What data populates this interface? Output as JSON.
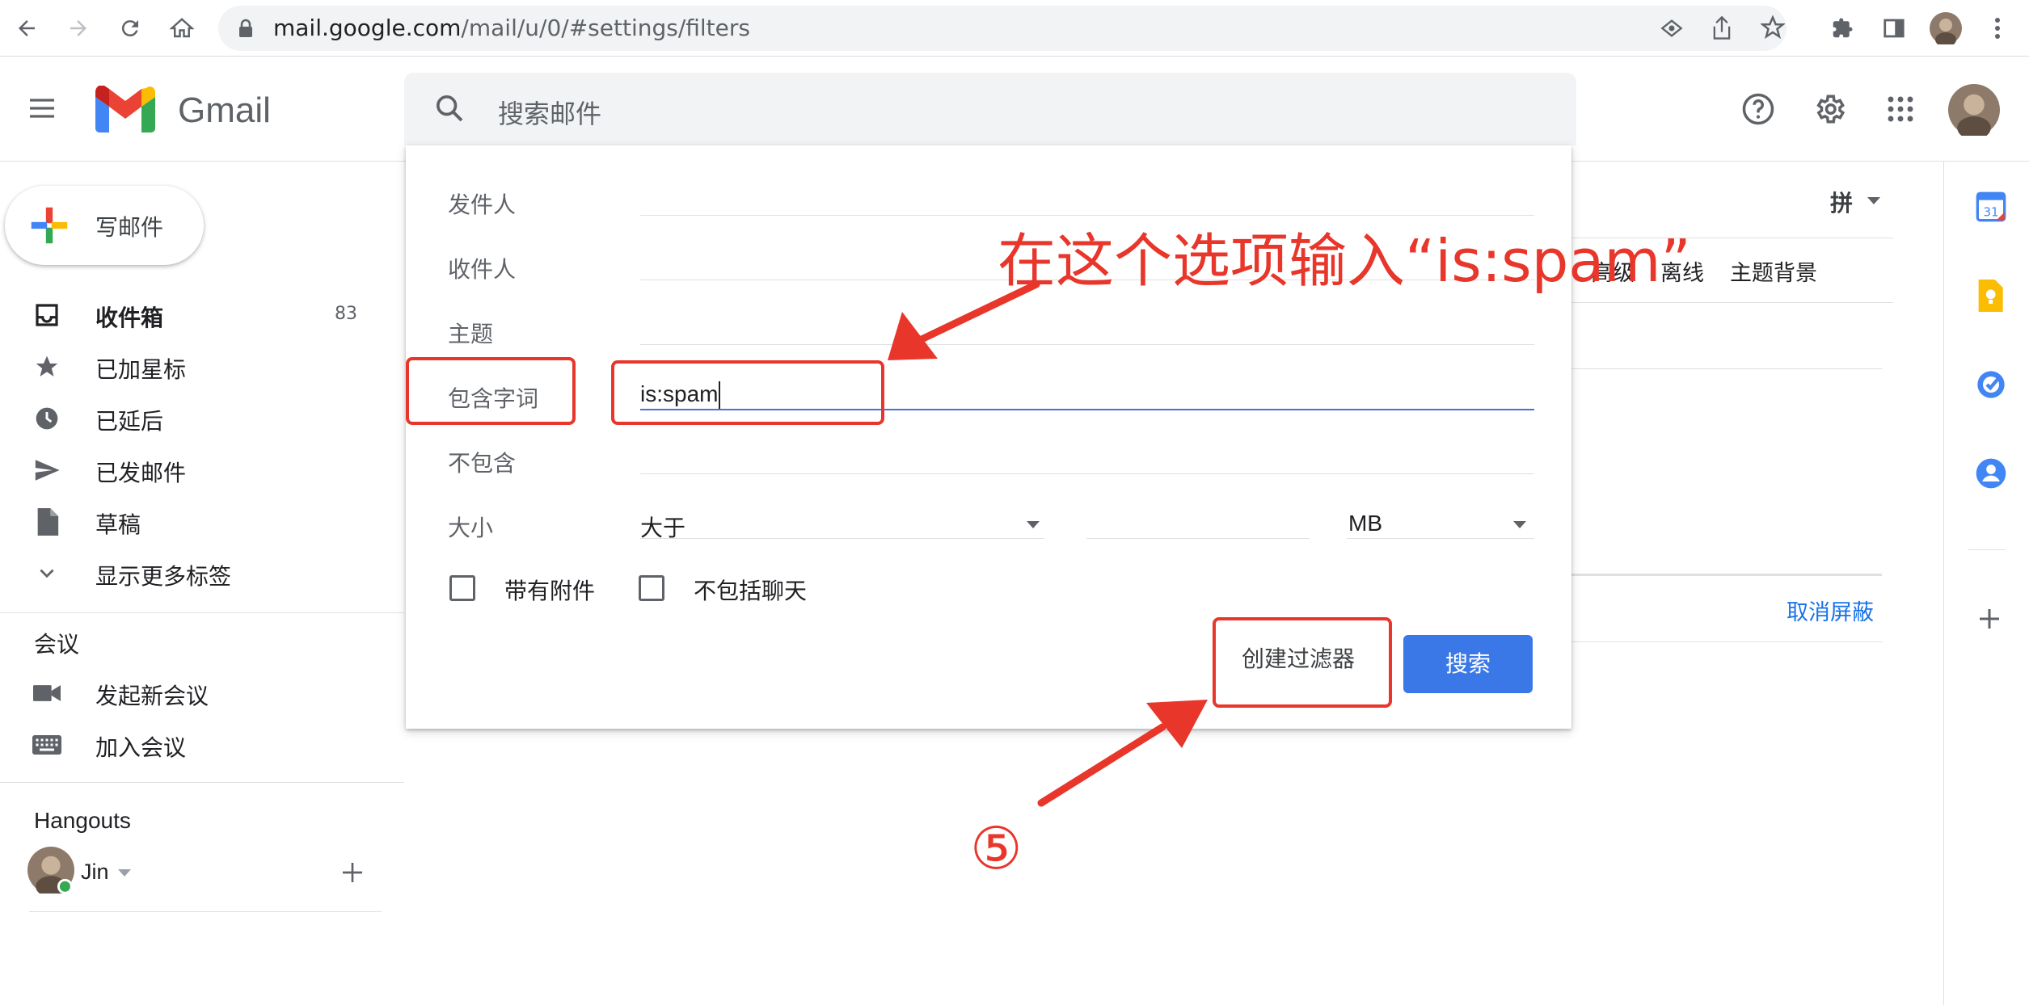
{
  "browser": {
    "url_host": "mail.google.com",
    "url_path": "/mail/u/0/#settings/filters"
  },
  "gmail": {
    "wordmark": "Gmail",
    "search_placeholder": "搜索邮件",
    "compose_label": "写邮件"
  },
  "sidebar": {
    "items": [
      {
        "label": "收件箱",
        "count": "83",
        "icon": "inbox-icon"
      },
      {
        "label": "已加星标",
        "count": "",
        "icon": "star-icon"
      },
      {
        "label": "已延后",
        "count": "",
        "icon": "clock-icon"
      },
      {
        "label": "已发邮件",
        "count": "",
        "icon": "send-icon"
      },
      {
        "label": "草稿",
        "count": "",
        "icon": "draft-icon"
      },
      {
        "label": "显示更多标签",
        "count": "",
        "icon": "chevron-down-icon"
      }
    ],
    "meet_header": "会议",
    "meet_items": [
      {
        "label": "发起新会议",
        "icon": "video-icon"
      },
      {
        "label": "加入会议",
        "icon": "keyboard-icon"
      }
    ],
    "hangouts_header": "Hangouts",
    "hangouts_user": "Jin"
  },
  "settings": {
    "tabs": [
      "高级",
      "离线",
      "主题背景"
    ],
    "unblock_link": "取消屏蔽",
    "ime_indicator": "拼"
  },
  "search_popup": {
    "from_label": "发件人",
    "to_label": "收件人",
    "subject_label": "主题",
    "has_words_label": "包含字词",
    "has_words_value": "is:spam",
    "doesnt_have_label": "不包含",
    "size_label": "大小",
    "size_operator": "大于",
    "size_unit": "MB",
    "has_attachment_label": "带有附件",
    "exclude_chats_label": "不包括聊天",
    "create_filter_label": "创建过滤器",
    "search_button_label": "搜索"
  },
  "annotation": {
    "instruction": "在这个选项输入“is:spam”",
    "step_number": "⑤",
    "color": "#e8362b"
  }
}
